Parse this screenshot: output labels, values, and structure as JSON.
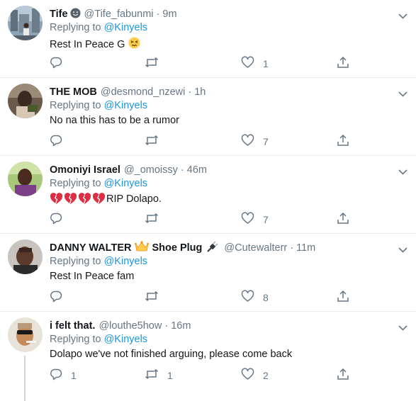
{
  "colors": {
    "accent": "#1b95e0",
    "secondary_text": "#657786",
    "primary_text": "#14171a",
    "divider": "#e6ecf0"
  },
  "replying_prefix": "Replying to",
  "tweets": [
    {
      "name": "Tife",
      "name_emoji": "grinning-face-icon",
      "name_extra": "",
      "handle": "@Tife_fabunmi",
      "separator": "·",
      "time": "9m",
      "reply_to": "@Kinyels",
      "text": "Rest In Peace G",
      "text_emoji": "persevering-face-icon",
      "replies": "",
      "retweets": "",
      "likes": "1"
    },
    {
      "name": "THE MOB",
      "name_extra": "",
      "handle": "@desmond_nzewi",
      "separator": "·",
      "time": "1h",
      "reply_to": "@Kinyels",
      "text": "No na this has to be a rumor",
      "replies": "",
      "retweets": "",
      "likes": "7"
    },
    {
      "name": "Omoniyi Israel",
      "name_extra": "",
      "handle": "@_omoissy",
      "separator": "·",
      "time": "46m",
      "reply_to": "@Kinyels",
      "text": "RIP Dolapo.",
      "text_emoji": "broken-heart-icon",
      "replies": "",
      "retweets": "",
      "likes": "7"
    },
    {
      "name": "DANNY WALTER",
      "name_emoji": "crown-icon",
      "name_extra": "Shoe Plug",
      "name_extra_emoji": "electric-plug-icon",
      "handle": "@Cutewalterr",
      "separator": "·",
      "time": "11m",
      "reply_to": "@Kinyels",
      "text": "Rest In Peace fam",
      "replies": "",
      "retweets": "",
      "likes": "8"
    },
    {
      "name": "i felt that.",
      "name_extra": "",
      "handle": "@louthe5how",
      "separator": "·",
      "time": "16m",
      "reply_to": "@Kinyels",
      "text": "Dolapo we've not finished arguing, please come back",
      "replies": "1",
      "retweets": "1",
      "likes": "2"
    }
  ]
}
